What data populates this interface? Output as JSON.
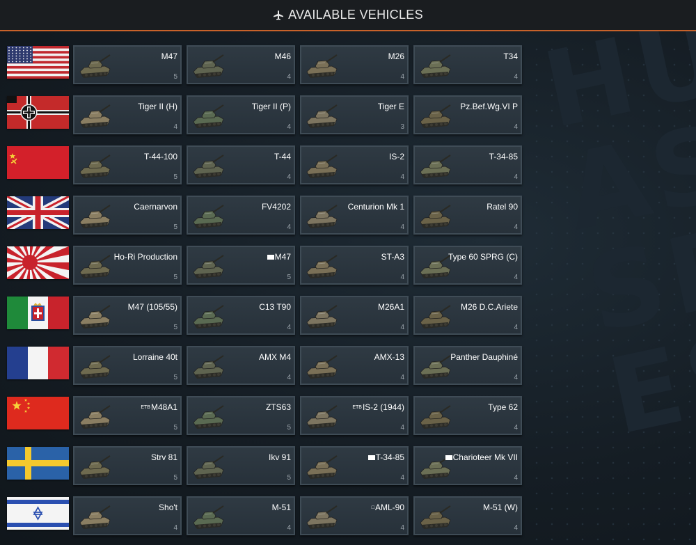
{
  "header": {
    "title": "AVAILABLE VEHICLES",
    "icon": "aircraft-icon"
  },
  "background": {
    "letters": "HU\nAS\nSP\nES"
  },
  "nations": [
    {
      "flag": "usa",
      "vehicles": [
        {
          "name": "M47",
          "rank": "5"
        },
        {
          "name": "M46",
          "rank": "4"
        },
        {
          "name": "M26",
          "rank": "4"
        },
        {
          "name": "T34",
          "rank": "4"
        }
      ]
    },
    {
      "flag": "germany",
      "vehicles": [
        {
          "name": "Tiger II (H)",
          "rank": "4"
        },
        {
          "name": "Tiger II (P)",
          "rank": "4"
        },
        {
          "name": "Tiger E",
          "rank": "3"
        },
        {
          "name": "Pz.Bef.Wg.VI P",
          "rank": "4"
        }
      ]
    },
    {
      "flag": "ussr",
      "vehicles": [
        {
          "name": "T-44-100",
          "rank": "5"
        },
        {
          "name": "T-44",
          "rank": "4"
        },
        {
          "name": "IS-2",
          "rank": "4"
        },
        {
          "name": "T-34-85",
          "rank": "4"
        }
      ]
    },
    {
      "flag": "uk",
      "vehicles": [
        {
          "name": "Caernarvon",
          "rank": "5"
        },
        {
          "name": "FV4202",
          "rank": "4"
        },
        {
          "name": "Centurion Mk 1",
          "rank": "4"
        },
        {
          "name": "Ratel 90",
          "rank": "4"
        }
      ]
    },
    {
      "flag": "japan",
      "vehicles": [
        {
          "name": "Ho-Ri Production",
          "rank": "5"
        },
        {
          "name": "M47",
          "rank": "5",
          "mark": true
        },
        {
          "name": "ST-A3",
          "rank": "4"
        },
        {
          "name": "Type 60 SPRG (C)",
          "rank": "4"
        }
      ]
    },
    {
      "flag": "italy",
      "vehicles": [
        {
          "name": "M47 (105/55)",
          "rank": "5"
        },
        {
          "name": "C13 T90",
          "rank": "4"
        },
        {
          "name": "M26A1",
          "rank": "4"
        },
        {
          "name": "M26 D.C.Ariete",
          "rank": "4"
        }
      ]
    },
    {
      "flag": "france",
      "vehicles": [
        {
          "name": "Lorraine 40t",
          "rank": "5"
        },
        {
          "name": "AMX M4",
          "rank": "4"
        },
        {
          "name": "AMX-13",
          "rank": "4"
        },
        {
          "name": "Panther Dauphiné",
          "rank": "4"
        }
      ]
    },
    {
      "flag": "china",
      "vehicles": [
        {
          "name": "M48A1",
          "rank": "5",
          "prefix": "ETB"
        },
        {
          "name": "ZTS63",
          "rank": "5"
        },
        {
          "name": "IS-2 (1944)",
          "rank": "4",
          "prefix": "ETB"
        },
        {
          "name": "Type 62",
          "rank": "4"
        }
      ]
    },
    {
      "flag": "sweden",
      "vehicles": [
        {
          "name": "Strv 81",
          "rank": "5"
        },
        {
          "name": "Ikv 91",
          "rank": "5"
        },
        {
          "name": "T-34-85",
          "rank": "4",
          "mark": true
        },
        {
          "name": "Charioteer Mk VII",
          "rank": "4",
          "mark": true
        }
      ]
    },
    {
      "flag": "israel",
      "vehicles": [
        {
          "name": "Sho't",
          "rank": "4"
        },
        {
          "name": "M-51",
          "rank": "4"
        },
        {
          "name": "AML-90",
          "rank": "4",
          "prefix": "□"
        },
        {
          "name": "M-51 (W)",
          "rank": "4"
        }
      ]
    }
  ],
  "colors": {
    "accent": "#c8622a",
    "card_border": "#3f4c56",
    "card_bg": "#2f3a43"
  }
}
